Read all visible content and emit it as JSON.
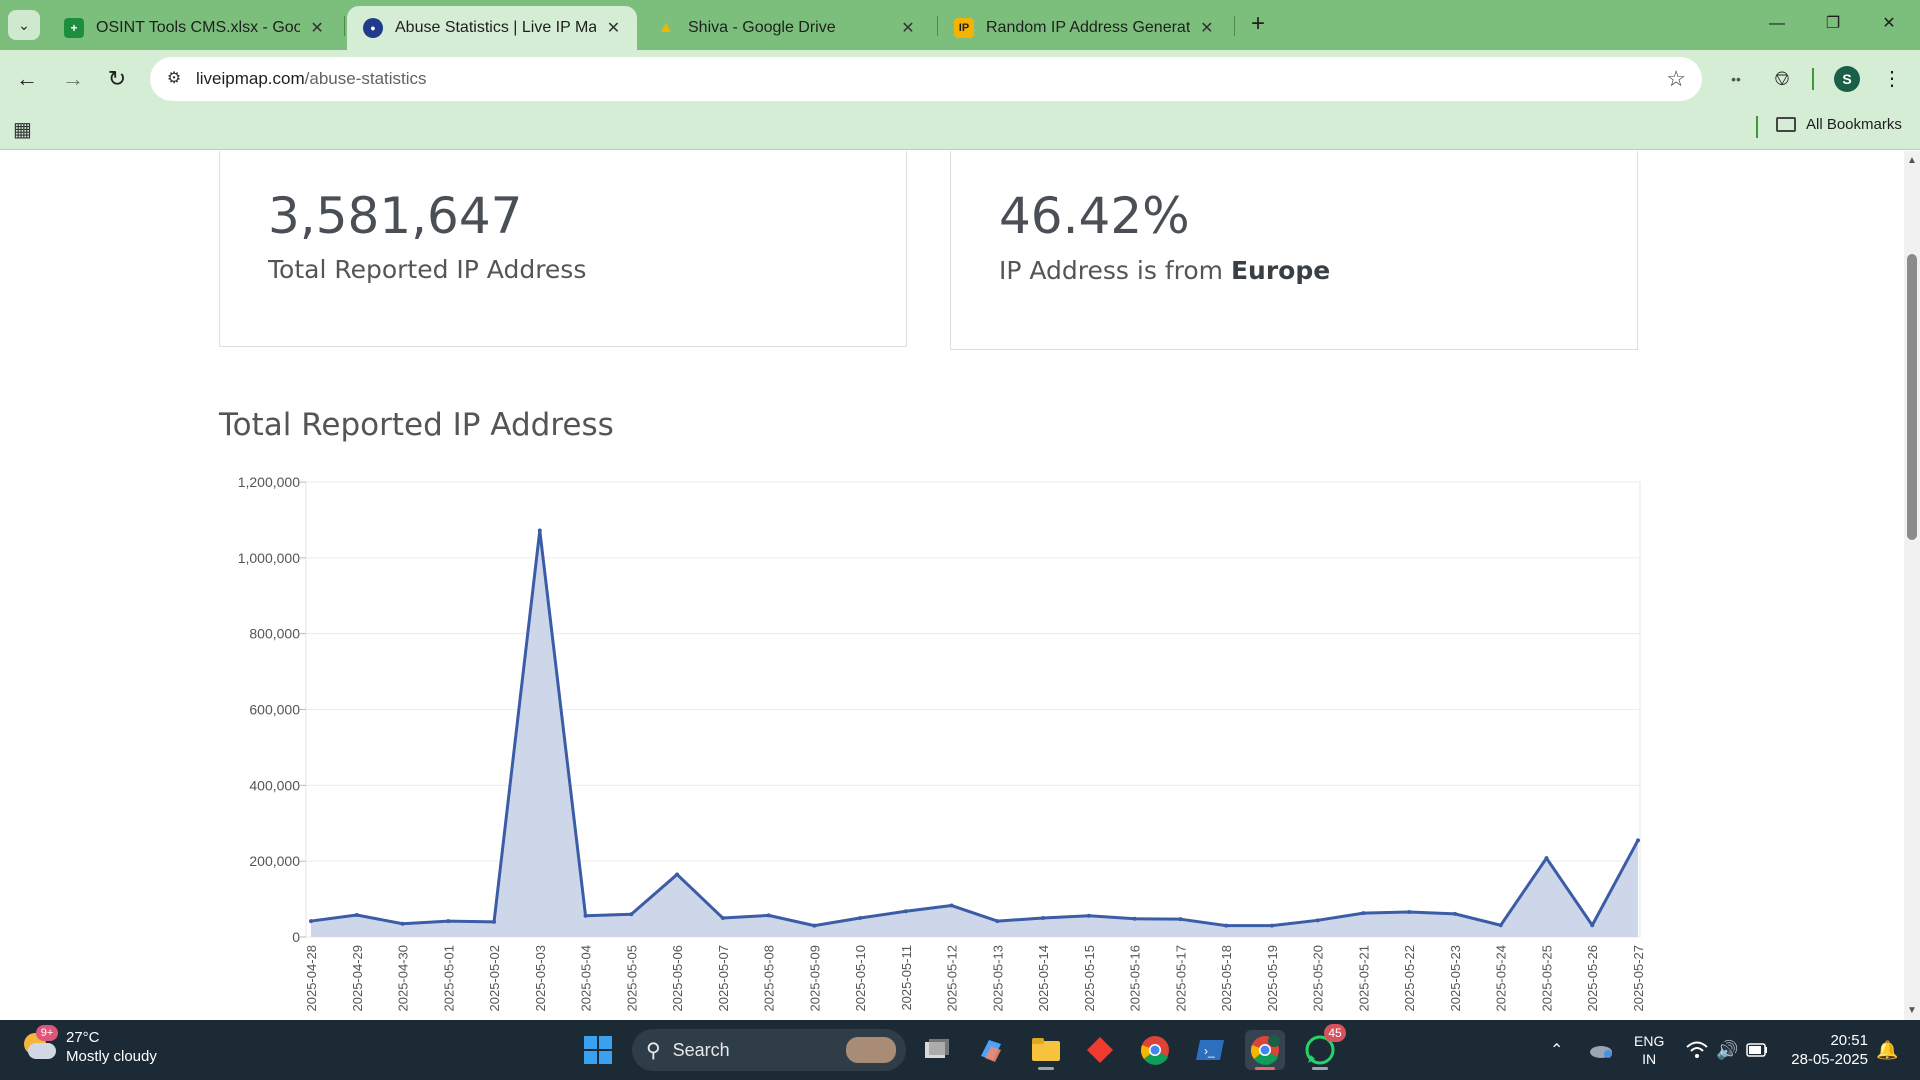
{
  "browser": {
    "tabs": [
      {
        "title": "OSINT Tools CMS.xlsx - Google",
        "favicon": "sheets-icon",
        "favicon_color": "#1e8e3e",
        "favicon_glyph": "+"
      },
      {
        "title": "Abuse Statistics | Live IP Map",
        "favicon": "liveipmap-icon",
        "favicon_color": "#1f3b8c",
        "favicon_glyph": "●"
      },
      {
        "title": "Shiva - Google Drive",
        "favicon": "drive-icon",
        "favicon_color": "#f4b400",
        "favicon_glyph": "▲"
      },
      {
        "title": "Random IP Address Generator,",
        "favicon": "ip-icon",
        "favicon_color": "#f6b400",
        "favicon_glyph": "IP"
      }
    ],
    "close_glyph": "✕",
    "new_tab_glyph": "+",
    "url_domain": "liveipmap.com",
    "url_path": "/abuse-statistics",
    "profile_initial": "S",
    "all_bookmarks": "All Bookmarks"
  },
  "page": {
    "stat_total": {
      "value": "3,581,647",
      "label": "Total Reported IP Address"
    },
    "stat_region": {
      "value": "46.42%",
      "label_prefix": "IP Address is from ",
      "label_region": "Europe"
    },
    "section_title": "Total Reported IP Address"
  },
  "chart_data": {
    "type": "area",
    "title": "",
    "xlabel": "",
    "ylabel": "",
    "x": [
      "2025-04-28",
      "2025-04-29",
      "2025-04-30",
      "2025-05-01",
      "2025-05-02",
      "2025-05-03",
      "2025-05-04",
      "2025-05-05",
      "2025-05-06",
      "2025-05-07",
      "2025-05-08",
      "2025-05-09",
      "2025-05-10",
      "2025-05-11",
      "2025-05-12",
      "2025-05-13",
      "2025-05-14",
      "2025-05-15",
      "2025-05-16",
      "2025-05-17",
      "2025-05-18",
      "2025-05-19",
      "2025-05-20",
      "2025-05-21",
      "2025-05-22",
      "2025-05-23",
      "2025-05-24",
      "2025-05-25",
      "2025-05-26",
      "2025-05-27"
    ],
    "values": [
      42000,
      58000,
      35000,
      42000,
      40000,
      1072000,
      56000,
      60000,
      165000,
      50000,
      57000,
      30000,
      50000,
      68000,
      83000,
      42000,
      50000,
      56000,
      48000,
      47000,
      30000,
      30000,
      44000,
      63000,
      66000,
      61000,
      31000,
      208000,
      31000,
      255000
    ],
    "ylim": [
      0,
      1200000
    ],
    "yticks": [
      0,
      200000,
      400000,
      600000,
      800000,
      1000000,
      1200000
    ],
    "ytick_labels": [
      "0",
      "200,000",
      "400,000",
      "600,000",
      "800,000",
      "1,000,000",
      "1,200,000"
    ],
    "line_color": "#3b5ca6",
    "fill_color": "#cbd5e8",
    "grid": true
  },
  "taskbar": {
    "weather_temp": "27°C",
    "weather_desc": "Mostly cloudy",
    "weather_badge": "9+",
    "search_label": "Search",
    "whatsapp_count": "45",
    "lang_line1": "ENG",
    "lang_line2": "IN",
    "time": "20:51",
    "date": "28-05-2025"
  }
}
